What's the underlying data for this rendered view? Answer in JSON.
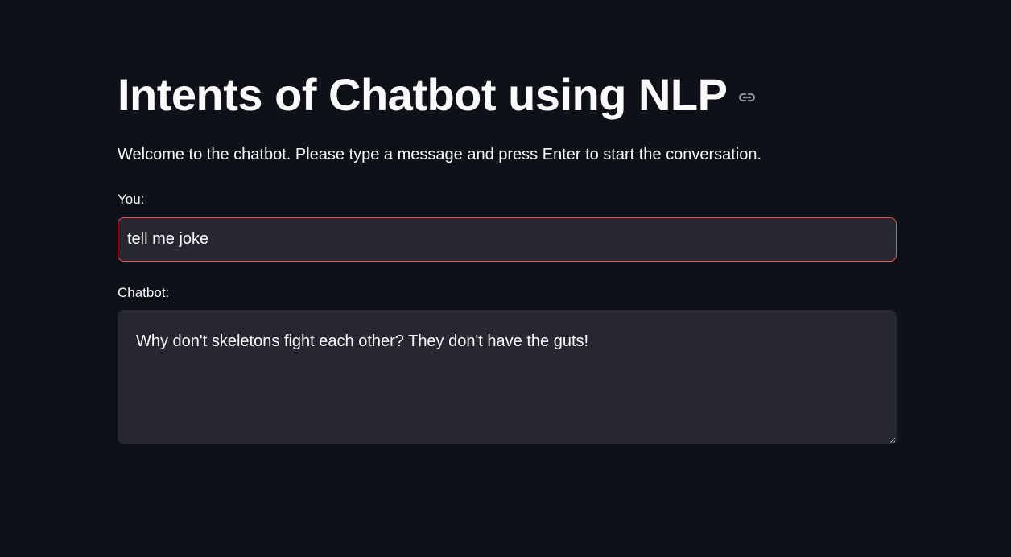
{
  "header": {
    "title": "Intents of Chatbot using NLP",
    "anchor_icon": "link-icon"
  },
  "intro": {
    "welcome_text": "Welcome to the chatbot. Please type a message and press Enter to start the conversation."
  },
  "user_input": {
    "label": "You:",
    "value": "tell me joke"
  },
  "bot_output": {
    "label": "Chatbot:",
    "value": "Why don't skeletons fight each other? They don't have the guts!"
  },
  "colors": {
    "background": "#0e1117",
    "input_background": "#262730",
    "focus_border": "#ff4b4b",
    "text": "#fafafa"
  }
}
